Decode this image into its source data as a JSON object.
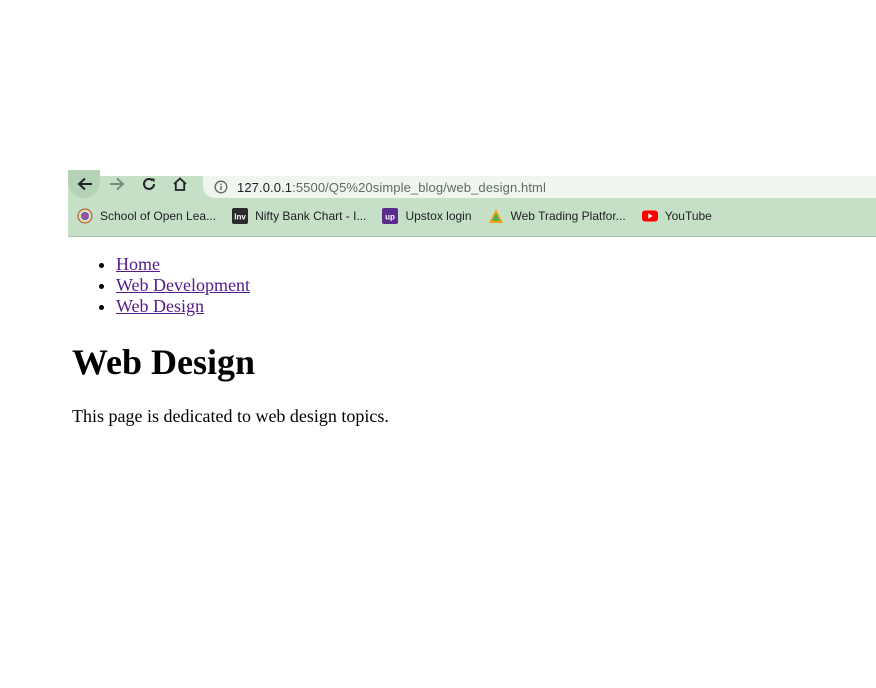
{
  "browser": {
    "url_host": "127.0.0.1",
    "url_rest": ":5500/Q5%20simple_blog/web_design.html",
    "bookmarks": [
      {
        "label": "School of Open Lea...",
        "icon": "university-seal-icon"
      },
      {
        "label": "Nifty Bank Chart - I...",
        "icon": "investing-logo-icon"
      },
      {
        "label": "Upstox login",
        "icon": "upstox-logo-icon"
      },
      {
        "label": "Web Trading Platfor...",
        "icon": "pyramid-logo-icon"
      },
      {
        "label": "YouTube",
        "icon": "youtube-logo-icon"
      }
    ],
    "colors": {
      "chrome_bg": "#c5e0c7",
      "omnibox_bg": "#eff5ef",
      "visited_link": "#551a8b"
    }
  },
  "page": {
    "nav": [
      {
        "label": "Home"
      },
      {
        "label": "Web Development"
      },
      {
        "label": "Web Design"
      }
    ],
    "title": "Web Design",
    "text": "This page is dedicated to web design topics."
  }
}
